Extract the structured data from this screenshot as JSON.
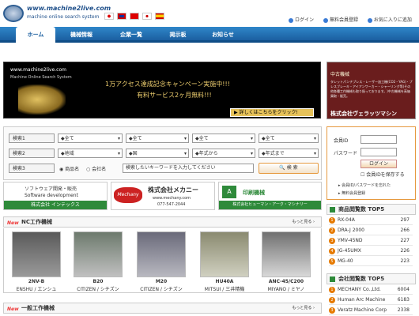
{
  "header": {
    "url": "www.machine2live.com",
    "tagline": "machine online search system"
  },
  "top_links": [
    "ログイン",
    "無料会員登録",
    "お気に入りに追加"
  ],
  "nav": [
    "ホーム",
    "機械情報",
    "企業一覧",
    "掲示板",
    "お知らせ"
  ],
  "banner": {
    "site": "www.machine2live.com",
    "sub": "Machine Online Search System",
    "line1": "1万アクセス達成記念キャンペーン実施中!!!",
    "line2": "有料サービス2ヶ月無料!!!",
    "cta": "詳しくはこちらをクリック!"
  },
  "ad_right": {
    "badge": "中古機械",
    "body": "タレットパンチプレス・レーザー加工機(CO2・YAG)・プレスブレーキ・アイアンワーカー・シャーリング等(その他各種工作機械も取り扱っております。)中古機械を高価買取・販売。",
    "company": "株式会社ヴェラッツマシン"
  },
  "search": {
    "labels": [
      "検索1",
      "検索2",
      "検索3"
    ],
    "row1": [
      "◆全て",
      "◆全て",
      "◆全て",
      "◆全て"
    ],
    "row2": [
      "◆地域",
      "◆国",
      "◆年式から",
      "◆年式まで"
    ],
    "radio": [
      "商品名",
      "会社名"
    ],
    "placeholder": "検索したいキーワードを入力してください",
    "button": "検 索"
  },
  "login": {
    "id_label": "会員ID",
    "pw_label": "パスワード",
    "button": "ログイン",
    "save": "会員IDを保存する",
    "forgot": "会員ID/パスワードを忘れた",
    "register": "無料会員登録"
  },
  "ads": [
    {
      "line1": "ソフトウェア開発・販売",
      "line2": "Software development",
      "line3": "株式会社 インテックス"
    },
    {
      "logo": "Mechany",
      "name": "株式会社メカニー",
      "url": "www.mechany.com",
      "tel": "077-547-2044"
    },
    {
      "name": "印刷機械",
      "company": "株式会社ヒューマン・アーク・マシナリー"
    }
  ],
  "nc": {
    "title": "NC工作機械",
    "more": "もっと見る ›",
    "items": [
      {
        "model": "2NV-B",
        "maker": "ENSHU / エンシュ"
      },
      {
        "model": "B20",
        "maker": "CITIZEN / シチズン"
      },
      {
        "model": "M20",
        "maker": "CITIZEN / シチズン"
      },
      {
        "model": "HU40A",
        "maker": "MITSUI / 三井精機"
      },
      {
        "model": "ANC-45/C200",
        "maker": "MIYANO / ミヤノ"
      }
    ]
  },
  "general": {
    "title": "一般工作機械",
    "more": "もっと見る ›"
  },
  "products_top5": {
    "title": "商品閲覧数 TOP5",
    "items": [
      {
        "name": "RX-04A",
        "count": "297"
      },
      {
        "name": "DRA-J 2000",
        "count": "266"
      },
      {
        "name": "YMV-45ND",
        "count": "227"
      },
      {
        "name": "JG-45UMX",
        "count": "226"
      },
      {
        "name": "MG-40",
        "count": "223"
      }
    ]
  },
  "companies_top5": {
    "title": "会社閲覧数 TOP5",
    "items": [
      {
        "name": "MECHANY Co.,Ltd.",
        "count": "6004"
      },
      {
        "name": "Human Arc Machine",
        "count": "6183"
      },
      {
        "name": "Veratz Machine Corp",
        "count": "2338"
      }
    ]
  },
  "colors": {
    "nav": "#1b5fa0",
    "accent": "#e67a00",
    "banner_bg": "#000000",
    "ad_bg": "#6a1d1d"
  }
}
